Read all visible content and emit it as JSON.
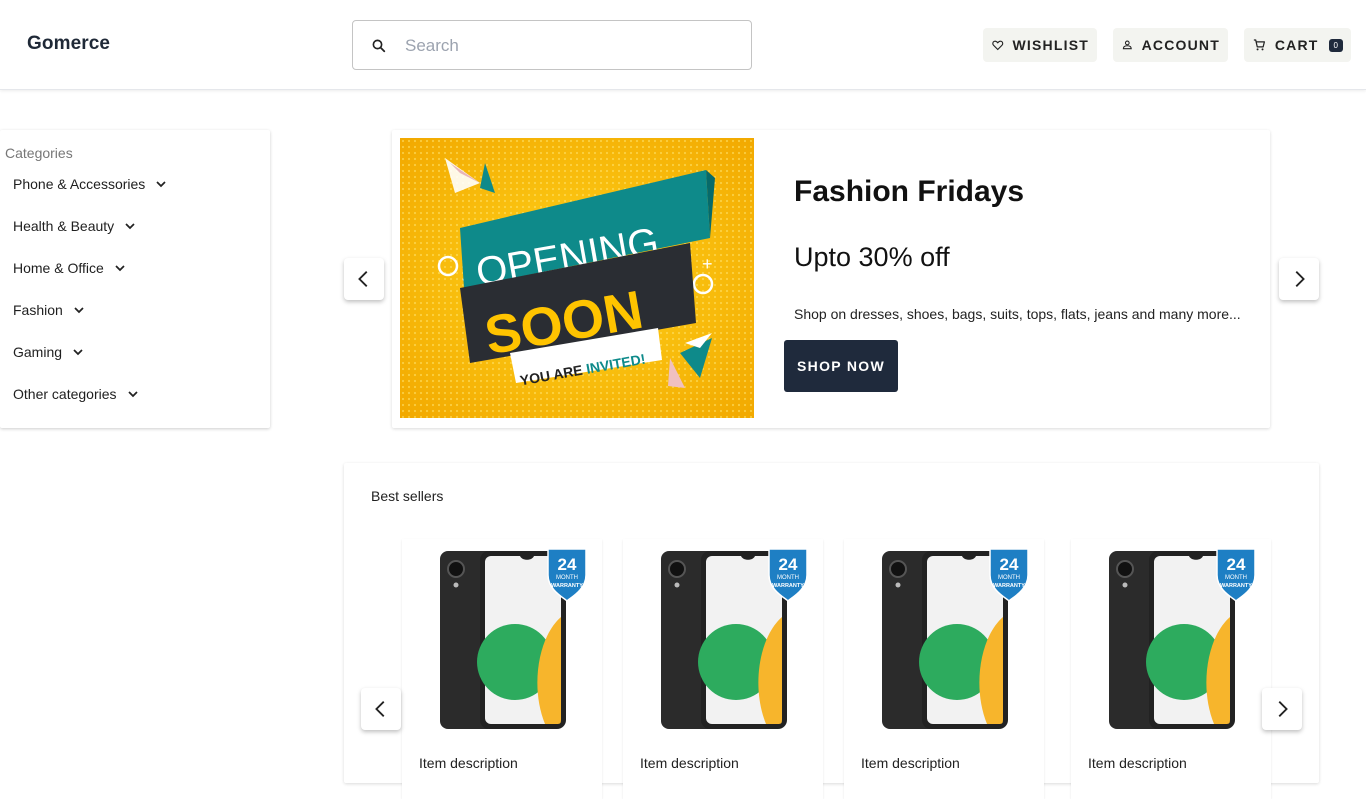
{
  "header": {
    "brand": "Gomerce",
    "search_placeholder": "Search",
    "wishlist_label": "WISHLIST",
    "account_label": "ACCOUNT",
    "cart_label": "CART",
    "cart_count": "0"
  },
  "sidebar": {
    "title": "Categories",
    "items": [
      {
        "label": "Phone & Accessories"
      },
      {
        "label": "Health & Beauty"
      },
      {
        "label": "Home & Office"
      },
      {
        "label": "Fashion"
      },
      {
        "label": "Gaming"
      },
      {
        "label": "Other categories"
      }
    ]
  },
  "hero": {
    "title": "Fashion Fridays",
    "subtitle": "Upto 30% off",
    "description": "Shop on dresses, shoes, bags, suits, tops, flats, jeans and many more...",
    "cta": "SHOP NOW",
    "promo": {
      "line1": "OPENING",
      "line2": "SOON",
      "line3a": "YOU ARE ",
      "line3b": "INVITED!"
    }
  },
  "best_sellers": {
    "title": "Best sellers",
    "badge_top": "24",
    "badge_mid": "MONTH",
    "badge_bot": "WARRANTY",
    "items": [
      {
        "description": "Item description"
      },
      {
        "description": "Item description"
      },
      {
        "description": "Item description"
      },
      {
        "description": "Item description"
      }
    ]
  },
  "colors": {
    "primary_dark": "#1f2a3c",
    "promo_yellow": "#f5b800",
    "promo_teal": "#0e8a8a",
    "badge_blue": "#1e7fc4"
  }
}
